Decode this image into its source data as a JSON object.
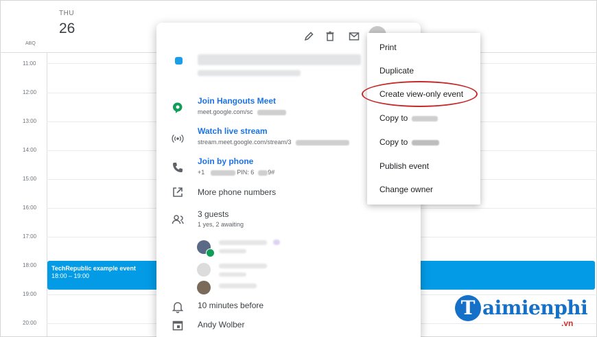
{
  "calendar": {
    "day_of_week": "THU",
    "day_number": "26",
    "timezone_label": "ABQ",
    "hours": [
      "11:00",
      "12:00",
      "13:00",
      "14:00",
      "15:00",
      "16:00",
      "17:00",
      "18:00",
      "19:00",
      "20:00"
    ],
    "event": {
      "title": "TechRepublic example event",
      "time": "18:00 – 19:00",
      "color": "#039be5"
    }
  },
  "popup": {
    "toolbar": {
      "edit_icon": "pencil-icon",
      "delete_icon": "trash-icon",
      "email_icon": "mail-icon"
    },
    "hangouts": {
      "label": "Join Hangouts Meet",
      "url": "meet.google.com/sc"
    },
    "livestream": {
      "label": "Watch live stream",
      "url": "stream.meet.google.com/stream/3"
    },
    "phone": {
      "label": "Join by phone",
      "detail": "+1 ",
      "pin": "PIN: 6",
      "pin_suffix": "9#"
    },
    "more_phones": "More phone numbers",
    "guests": {
      "count": "3 guests",
      "summary": "1 yes, 2 awaiting"
    },
    "reminder": "10 minutes before",
    "organizer": "Andy Wolber"
  },
  "menu": {
    "items": [
      "Print",
      "Duplicate",
      "Create view-only event",
      "Copy to",
      "Copy to",
      "Publish event",
      "Change owner"
    ],
    "highlight_color": "#c62828"
  },
  "watermark": {
    "letter": "T",
    "brand": "aimienphi",
    "domain": ".vn"
  }
}
